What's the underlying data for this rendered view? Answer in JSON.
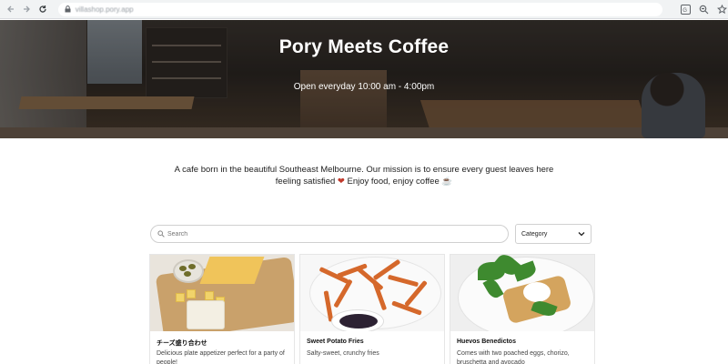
{
  "browser": {
    "url": "villashop.pory.app"
  },
  "hero": {
    "title": "Pory Meets Coffee",
    "subtitle": "Open everyday 10:00 am - 4:00pm"
  },
  "mission": {
    "text": "A cafe born in the beautiful Southeast Melbourne. Our mission is to ensure every guest leaves here feeling satisfied",
    "heart": "❤",
    "tail": " Enjoy food, enjoy coffee ☕"
  },
  "search": {
    "placeholder": "Search"
  },
  "category": {
    "selected": "Category"
  },
  "menu": {
    "items": [
      {
        "name": "チーズ盛り合わせ",
        "description": "Delicious plate appetizer perfect for a party of people!"
      },
      {
        "name": "Sweet Potato Fries",
        "description": "Salty-sweet, crunchy fries"
      },
      {
        "name": "Huevos Benedictos",
        "description": "Comes with two poached eggs, chorizo, bruschetta and avocado"
      }
    ]
  },
  "icons": {
    "back": "arrow-left-icon",
    "forward": "arrow-right-icon",
    "reload": "reload-icon",
    "lock": "lock-icon",
    "translate": "translate-icon",
    "zoom": "zoom-icon",
    "bookmark": "star-icon",
    "search": "search-icon",
    "dropdown": "chevron-down-icon"
  },
  "colors": {
    "heart": "#c0392b",
    "hero_text": "#ffffff",
    "border": "#d0d0d0"
  }
}
